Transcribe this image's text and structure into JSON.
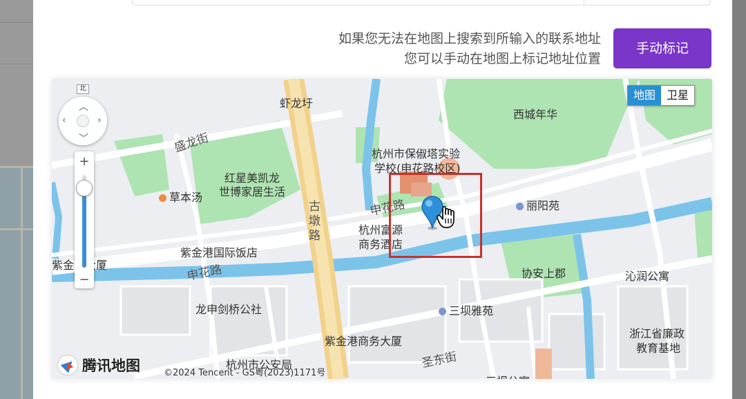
{
  "hint": {
    "line1": "如果您无法在地图上搜索到所输入的联系地址",
    "line2": "您可以手动在地图上标记地址位置"
  },
  "manual_mark_button": {
    "label": "手动标记",
    "color": "#7a35c9"
  },
  "map": {
    "type_switch": {
      "map": "地图",
      "satellite": "卫星",
      "active": "map"
    },
    "north_label": "北",
    "zoom": {
      "plus": "+",
      "minus": "−",
      "level": 0.85
    },
    "logo": "腾讯地图",
    "copyright": "©2024 Tencent - GS粤(2023)1171号",
    "labels": {
      "xialongyu": "虾龙圩",
      "xicheng_nianhua": "西城年华",
      "shenglong_street": "盛龙街",
      "hongxing": "红星美凯龙",
      "shibo": "世博家居生活",
      "caobentang": "草本汤",
      "school1": "杭州市保俶塔实验",
      "school2": "学校(申花路校区)",
      "shenhua_road_1": "申花路",
      "liyangyuan": "丽阳苑",
      "gudun_road": "古墩路",
      "fuyuan1": "杭州富源",
      "fuyuan2": "商务酒店",
      "zijingang_hotel": "紫金港国际饭店",
      "zijin_building": "紫金创大厦",
      "shenhua_road_2": "申花路",
      "xiean": "协安上郡",
      "qinrun": "沁润公寓",
      "longshen": "龙申剑桥公社",
      "sanba": "三坝雅苑",
      "lianzheng1": "浙江省廉政",
      "lianzheng2": "教育基地",
      "zijingang_business": "紫金港商务大厦",
      "shengdong": "圣东街",
      "police": "杭州市公安局",
      "sanba_gongyu": "三坝公寓"
    }
  }
}
